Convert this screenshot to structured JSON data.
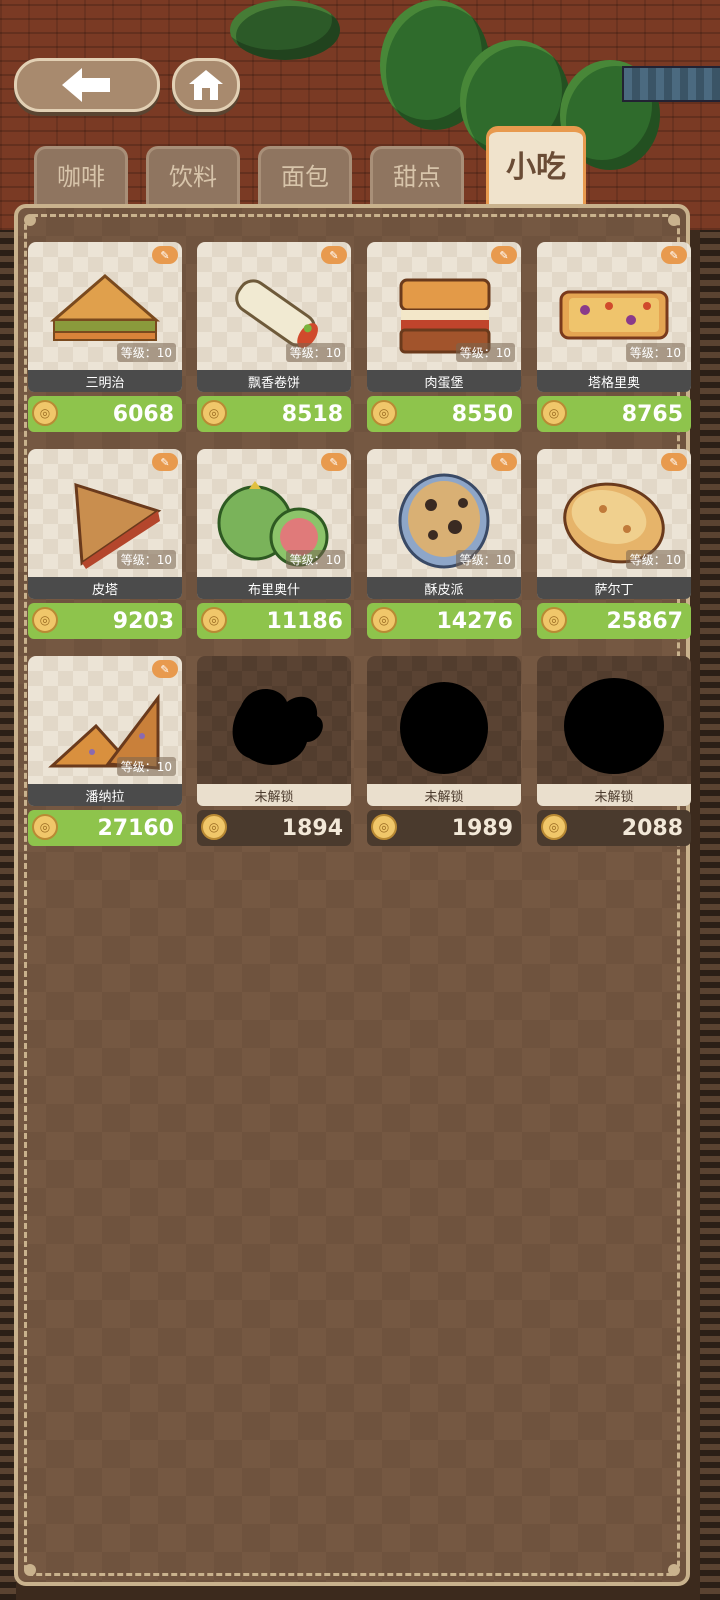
{
  "tabs": [
    {
      "label": "咖啡",
      "active": false
    },
    {
      "label": "饮料",
      "active": false
    },
    {
      "label": "面包",
      "active": false
    },
    {
      "label": "甜点",
      "active": false
    },
    {
      "label": "小吃",
      "active": true
    }
  ],
  "top_buttons": {
    "back_icon": "arrow-left-icon",
    "home_icon": "house-icon"
  },
  "items": [
    {
      "name": "三明治",
      "level": "等级：10",
      "price": "6068",
      "locked": false,
      "icon": "sandwich-icon"
    },
    {
      "name": "飘香卷饼",
      "level": "等级：10",
      "price": "8518",
      "locked": false,
      "icon": "burrito-icon"
    },
    {
      "name": "肉蛋堡",
      "level": "等级：10",
      "price": "8550",
      "locked": false,
      "icon": "burger-icon"
    },
    {
      "name": "塔格里奥",
      "level": "等级：10",
      "price": "8765",
      "locked": false,
      "icon": "pizza-slice-icon"
    },
    {
      "name": "皮塔",
      "level": "等级：10",
      "price": "9203",
      "locked": false,
      "icon": "pita-icon"
    },
    {
      "name": "布里奥什",
      "level": "等级：10",
      "price": "11186",
      "locked": false,
      "icon": "guava-icon"
    },
    {
      "name": "酥皮派",
      "level": "等级：10",
      "price": "14276",
      "locked": false,
      "icon": "pie-icon"
    },
    {
      "name": "萨尔丁",
      "level": "等级：10",
      "price": "25867",
      "locked": false,
      "icon": "flatbread-icon"
    },
    {
      "name": "潘纳拉",
      "level": "等级：10",
      "price": "27160",
      "locked": false,
      "icon": "toast-icon"
    },
    {
      "name": "未解锁",
      "level": "",
      "price": "1894",
      "locked": true,
      "icon": "locked-silhouette-icon"
    },
    {
      "name": "未解锁",
      "level": "",
      "price": "1989",
      "locked": true,
      "icon": "locked-silhouette-icon"
    },
    {
      "name": "未解锁",
      "level": "",
      "price": "2088",
      "locked": true,
      "icon": "locked-silhouette-icon"
    }
  ],
  "colors": {
    "price_green": "#8ec44c",
    "accent_orange": "#e89a4e",
    "panel_brown": "#755842"
  }
}
